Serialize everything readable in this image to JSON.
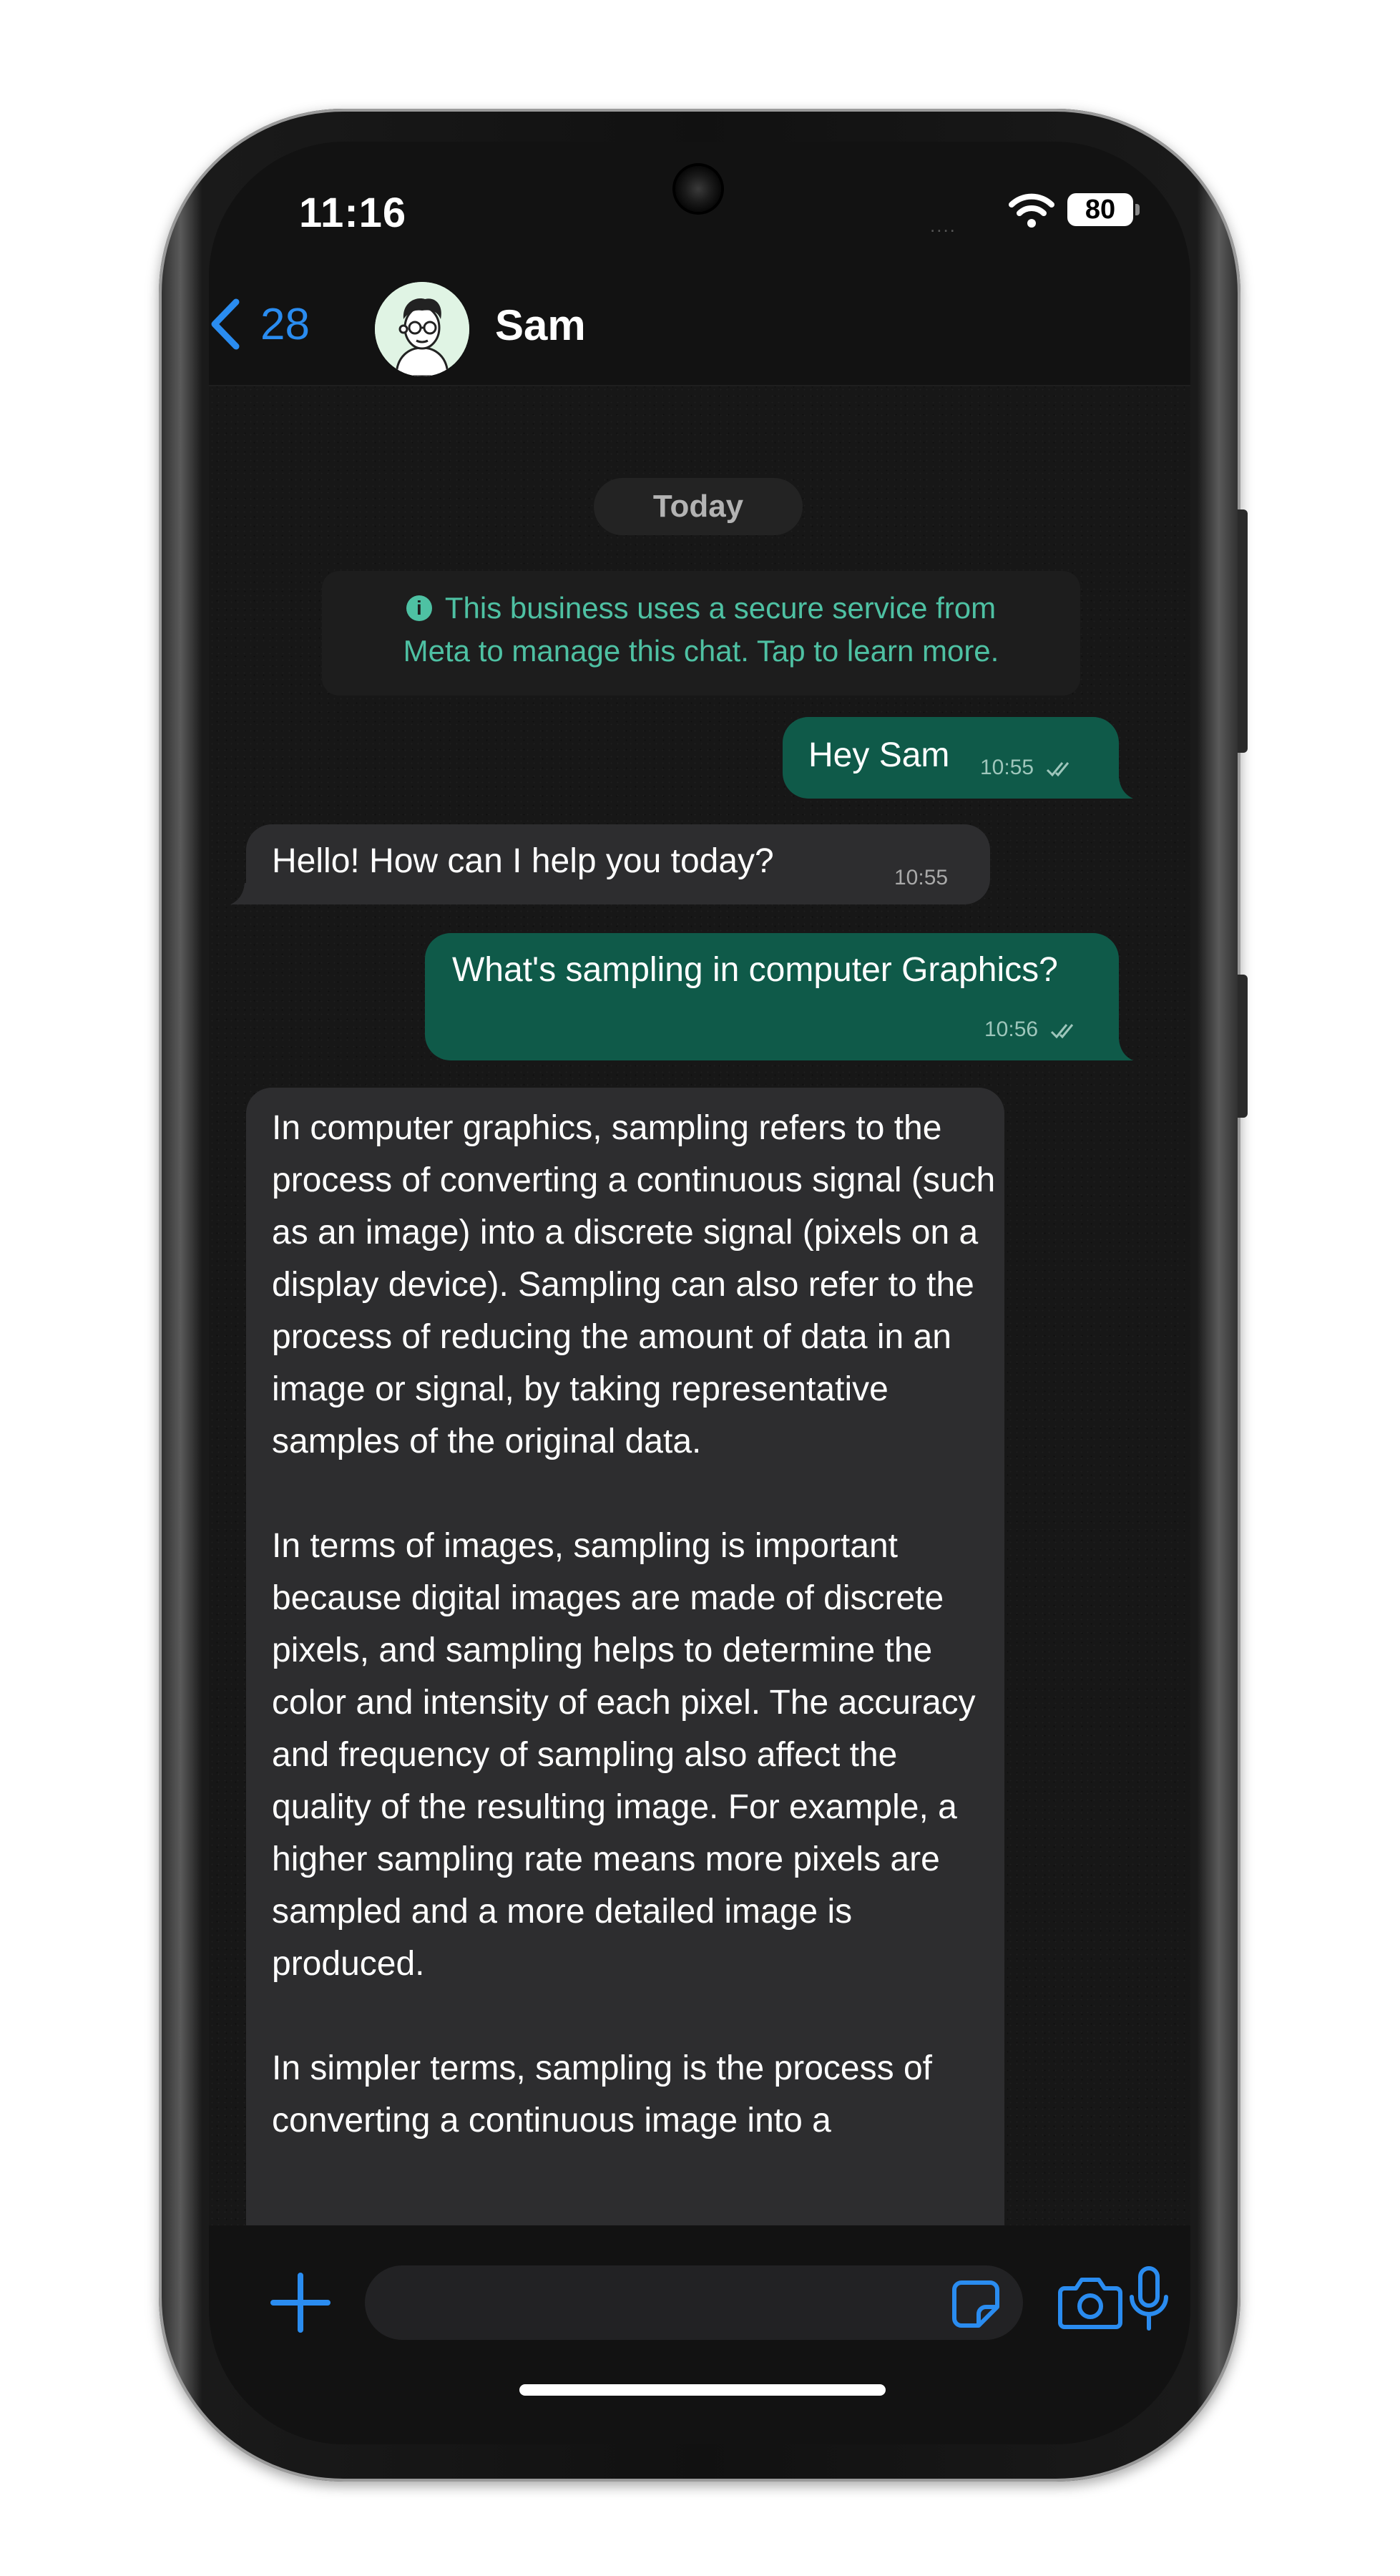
{
  "status_bar": {
    "time": "11:16",
    "battery": "80",
    "signal_dots": "....",
    "icons": [
      "wifi-icon",
      "battery-icon"
    ]
  },
  "header": {
    "back_count": "28",
    "contact_name": "Sam",
    "icons": [
      "chevron-left-icon",
      "avatar"
    ]
  },
  "chat": {
    "date_label": "Today",
    "system_notice": {
      "line1": "This business uses a secure service from",
      "line2": "Meta to manage this chat. Tap to learn more.",
      "icon": "info-icon"
    },
    "messages": [
      {
        "direction": "outgoing",
        "text": "Hey Sam",
        "time": "10:55",
        "status": "read"
      },
      {
        "direction": "incoming",
        "text": "Hello! How can I help you today?",
        "time": "10:55"
      },
      {
        "direction": "outgoing",
        "text": "What's sampling in computer Graphics?",
        "time": "10:56",
        "status": "read"
      },
      {
        "direction": "incoming",
        "paragraphs": [
          "In computer graphics, sampling refers to the process of converting a continuous signal (such as an image) into a discrete signal (pixels on a display device). Sampling can also refer to the process of reducing the amount of data in an image or signal, by taking representative samples of the original data.",
          "In terms of images, sampling is important because digital images are made of discrete pixels, and sampling helps to determine the color and intensity of each pixel. The accuracy and frequency of sampling also affect the quality of the resulting image. For example, a higher sampling rate means more pixels are sampled and a more detailed image is produced.",
          "In simpler terms, sampling is the process of converting a continuous image into a"
        ]
      }
    ]
  },
  "composer": {
    "input_value": "",
    "icons": [
      "plus-icon",
      "sticker-icon",
      "camera-icon",
      "microphone-icon"
    ]
  },
  "colors": {
    "accent": "#2a8cf0",
    "outgoing_bubble": "#0f5a49",
    "incoming_bubble": "#2d2d2f",
    "notice_text": "#4ec1a3"
  }
}
